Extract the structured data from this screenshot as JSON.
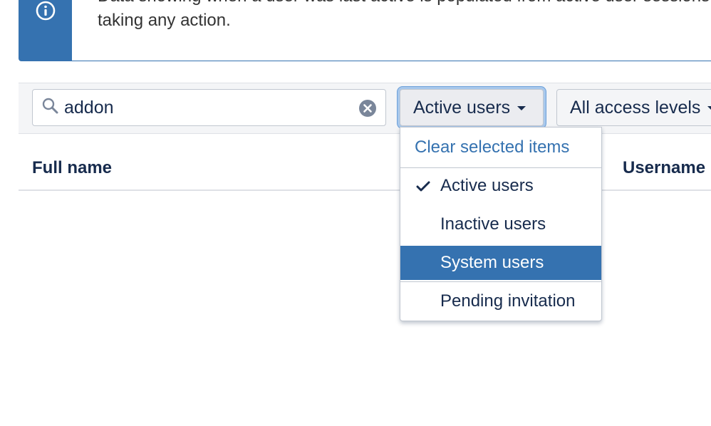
{
  "banner": {
    "line1": "Data showing when a user was last active is populated from active user sessions",
    "line2": "taking any action.",
    "icon": "info-icon",
    "color": "#3572b0"
  },
  "filters": {
    "search_value": "addon",
    "search_icon": "search-icon",
    "clear_icon": "clear-icon",
    "status_label": "Active users",
    "access_label": "All access levels"
  },
  "table": {
    "columns": [
      "Full name",
      "Username"
    ]
  },
  "menu": {
    "clear_label": "Clear selected items",
    "items": [
      {
        "label": "Active users",
        "checked": true,
        "highlighted": false
      },
      {
        "label": "Inactive users",
        "checked": false,
        "highlighted": false
      },
      {
        "label": "System users",
        "checked": false,
        "highlighted": true
      },
      {
        "label": "Pending invitation",
        "checked": false,
        "highlighted": false
      }
    ],
    "highlight_color": "#3572b0",
    "link_color": "#3572b0"
  }
}
